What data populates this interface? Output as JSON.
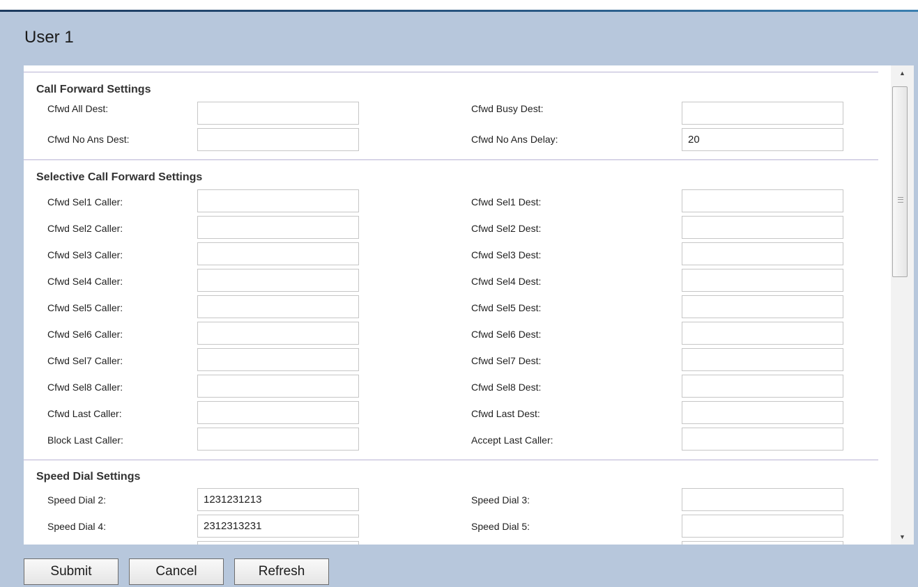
{
  "page": {
    "title": "User 1"
  },
  "call_forward": {
    "title": "Call Forward Settings",
    "rows": [
      {
        "left_label": "Cfwd All Dest:",
        "left_value": "",
        "right_label": "Cfwd Busy Dest:",
        "right_value": ""
      },
      {
        "left_label": "Cfwd No Ans Dest:",
        "left_value": "",
        "right_label": "Cfwd No Ans Delay:",
        "right_value": "20"
      }
    ]
  },
  "selective_call_forward": {
    "title": "Selective Call Forward Settings",
    "rows": [
      {
        "left_label": "Cfwd Sel1 Caller:",
        "left_value": "",
        "right_label": "Cfwd Sel1 Dest:",
        "right_value": ""
      },
      {
        "left_label": "Cfwd Sel2 Caller:",
        "left_value": "",
        "right_label": "Cfwd Sel2 Dest:",
        "right_value": ""
      },
      {
        "left_label": "Cfwd Sel3 Caller:",
        "left_value": "",
        "right_label": "Cfwd Sel3 Dest:",
        "right_value": ""
      },
      {
        "left_label": "Cfwd Sel4 Caller:",
        "left_value": "",
        "right_label": "Cfwd Sel4 Dest:",
        "right_value": ""
      },
      {
        "left_label": "Cfwd Sel5 Caller:",
        "left_value": "",
        "right_label": "Cfwd Sel5 Dest:",
        "right_value": ""
      },
      {
        "left_label": "Cfwd Sel6 Caller:",
        "left_value": "",
        "right_label": "Cfwd Sel6 Dest:",
        "right_value": ""
      },
      {
        "left_label": "Cfwd Sel7 Caller:",
        "left_value": "",
        "right_label": "Cfwd Sel7 Dest:",
        "right_value": ""
      },
      {
        "left_label": "Cfwd Sel8 Caller:",
        "left_value": "",
        "right_label": "Cfwd Sel8 Dest:",
        "right_value": ""
      },
      {
        "left_label": "Cfwd Last Caller:",
        "left_value": "",
        "right_label": "Cfwd Last Dest:",
        "right_value": ""
      },
      {
        "left_label": "Block Last Caller:",
        "left_value": "",
        "right_label": "Accept Last Caller:",
        "right_value": ""
      }
    ]
  },
  "speed_dial": {
    "title": "Speed Dial Settings",
    "rows": [
      {
        "left_label": "Speed Dial 2:",
        "left_value": "1231231213",
        "right_label": "Speed Dial 3:",
        "right_value": ""
      },
      {
        "left_label": "Speed Dial 4:",
        "left_value": "2312313231",
        "right_label": "Speed Dial 5:",
        "right_value": ""
      }
    ]
  },
  "buttons": {
    "submit": "Submit",
    "cancel": "Cancel",
    "refresh": "Refresh"
  },
  "icons": {
    "scroll_up": "scroll-up-arrow-icon",
    "scroll_down": "scroll-down-arrow-icon"
  }
}
